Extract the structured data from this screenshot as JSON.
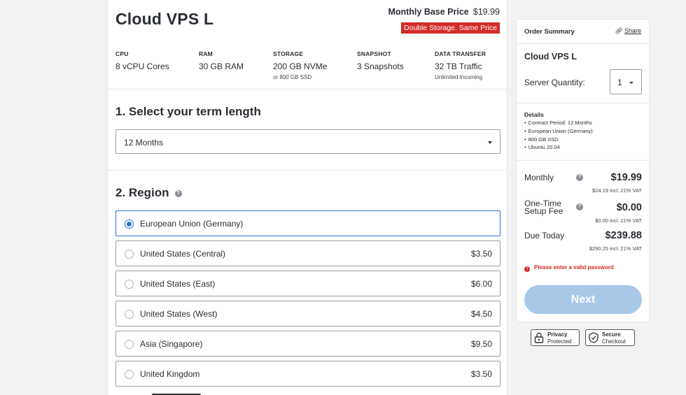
{
  "product": {
    "title": "Cloud VPS L",
    "base_price_label": "Monthly Base Price",
    "base_price": "$19.99",
    "promo": "Double Storage. Same Price"
  },
  "specs": [
    {
      "key": "CPU",
      "value": "8 vCPU Cores",
      "sub": ""
    },
    {
      "key": "RAM",
      "value": "30 GB RAM",
      "sub": ""
    },
    {
      "key": "STORAGE",
      "value": "200 GB NVMe",
      "sub": "or 800 GB SSD"
    },
    {
      "key": "SNAPSHOT",
      "value": "3 Snapshots",
      "sub": ""
    },
    {
      "key": "DATA TRANSFER",
      "value": "32 TB Traffic",
      "sub": "Unlimited Incoming"
    }
  ],
  "term": {
    "title": "1. Select your term length",
    "selected": "12 Months"
  },
  "region": {
    "title": "2. Region",
    "options": [
      {
        "name": "European Union (Germany)",
        "price": "",
        "selected": true
      },
      {
        "name": "United States (Central)",
        "price": "$3.50",
        "selected": false
      },
      {
        "name": "United States (East)",
        "price": "$6.00",
        "selected": false
      },
      {
        "name": "United States (West)",
        "price": "$4.50",
        "selected": false
      },
      {
        "name": "Asia (Singapore)",
        "price": "$9.50",
        "selected": false
      },
      {
        "name": "United Kingdom",
        "price": "$3.50",
        "selected": false
      }
    ]
  },
  "summary": {
    "heading": "Order Summary",
    "share": "Share",
    "product": "Cloud VPS L",
    "quantity_label": "Server Quantity:",
    "quantity": "1",
    "details_title": "Details",
    "details": [
      "Contract Period: 12 Months",
      "European Union (Germany)",
      "800 GB SSD",
      "Ubuntu 20.04"
    ],
    "monthly_label": "Monthly",
    "monthly": "$19.99",
    "monthly_vat": "$24.19 incl. 21% VAT",
    "setup_label_1": "One-Time",
    "setup_label_2": "Setup Fee",
    "setup": "$0.00",
    "setup_vat": "$0.00 incl. 21% VAT",
    "due_label": "Due Today",
    "due": "$239.88",
    "due_vat": "$290.25 incl. 21% VAT",
    "error": "Please enter a valid password",
    "next": "Next"
  },
  "badges": {
    "privacy_1": "Privacy",
    "privacy_2": "Protected",
    "secure_1": "Secure",
    "secure_2": "Checkout"
  },
  "colors": {
    "accent": "#2f6fd0",
    "promo": "#d42b27",
    "next_button": "#a8c8ea"
  }
}
